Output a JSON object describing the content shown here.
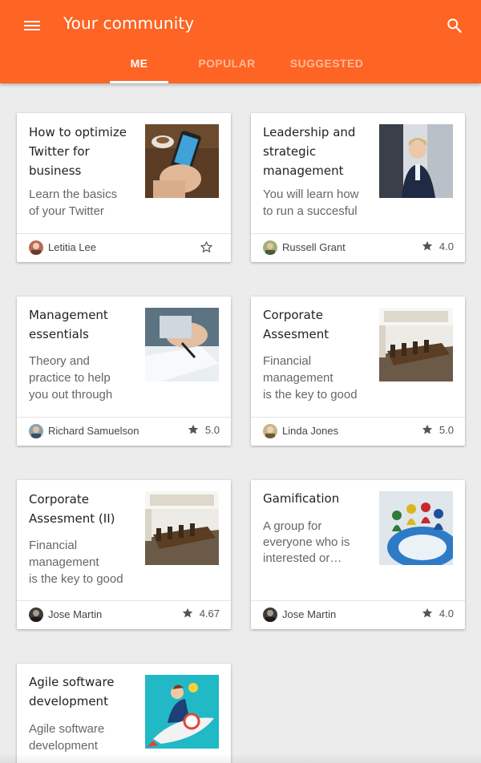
{
  "app": {
    "title": "Your community",
    "menu_icon": "menu-icon",
    "search_icon": "search-icon",
    "accent_color": "#fe6423"
  },
  "tabs": [
    {
      "label": "ME",
      "active": true
    },
    {
      "label": "POPULAR",
      "active": false
    },
    {
      "label": "SUGGESTED",
      "active": false
    }
  ],
  "cards": [
    {
      "title_lines": [
        "How to optimize",
        "Twitter for",
        "business"
      ],
      "desc_lines": [
        "Learn the basics",
        "of your Twitter"
      ],
      "author": "Letitia Lee",
      "rating": "",
      "favorite_icon": "star-outline-icon",
      "thumb": "phone-twitter"
    },
    {
      "title_lines": [
        "Leadership and",
        "strategic",
        "management"
      ],
      "desc_lines": [
        "You will learn how",
        "to run a succesful"
      ],
      "author": "Russell Grant",
      "rating": "4.0",
      "thumb": "business-meeting"
    },
    {
      "title_lines": [
        "Management",
        "essentials"
      ],
      "desc_lines": [
        "Theory and",
        "practice to help",
        "you out through"
      ],
      "author": "Richard Samuelson",
      "rating": "5.0",
      "thumb": "signing-document"
    },
    {
      "title_lines": [
        "Corporate",
        "Assesment"
      ],
      "desc_lines": [
        "Financial",
        "management",
        "is the key to good"
      ],
      "author": "Linda Jones",
      "rating": "5.0",
      "thumb": "conference-room"
    },
    {
      "title_lines": [
        "Corporate",
        "Assesment (II)"
      ],
      "desc_lines": [
        "Financial",
        "management",
        "is the key to good"
      ],
      "author": "Jose Martin",
      "rating": "4.67",
      "thumb": "conference-room"
    },
    {
      "title_lines": [
        "Gamification"
      ],
      "desc_lines": [
        "A group for",
        "everyone who is",
        "interested or…"
      ],
      "author": "Jose Martin",
      "rating": "4.0",
      "thumb": "board-game"
    },
    {
      "title_lines": [
        "Agile software",
        "development"
      ],
      "desc_lines": [
        "Agile software",
        "development"
      ],
      "author": "",
      "rating": "",
      "thumb": "rocket-idea"
    }
  ]
}
